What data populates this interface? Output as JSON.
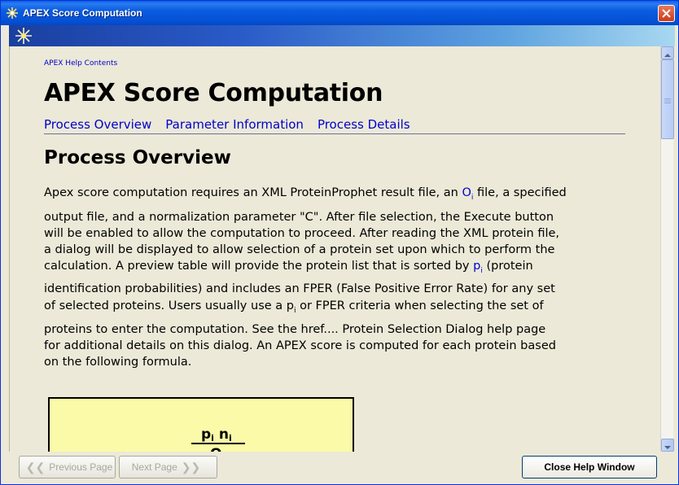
{
  "window": {
    "title": "APEX Score Computation",
    "accent_color": "#0a5ce0"
  },
  "content": {
    "help_link": "APEX Help Contents",
    "page_title": "APEX Score Computation",
    "nav": [
      {
        "label": "Process Overview"
      },
      {
        "label": "Parameter Information"
      },
      {
        "label": "Process Details"
      }
    ],
    "section_title": "Process Overview",
    "paragraph": {
      "l1a": "Apex score computation requires an XML ProteinProphet result file, an ",
      "o_sym": "O",
      "o_sub": "i",
      "l1b": " file, a specified",
      "l2": "output file, and a normalization parameter \"C\". After file selection, the Execute button",
      "l3": "will be enabled to allow the computation to proceed. After reading the XML protein file,",
      "l4": "a dialog will be displayed to allow selection of a protein set upon which to perform the",
      "l5a": "calculation. A preview table will provide the protein list that is sorted by ",
      "p_sym": "p",
      "p_sub": "i",
      "l5b": " (protein",
      "l6": "identification probabilities) and includes an FPER (False Positive Error Rate) for any set",
      "l7a": "of selected proteins. Users usually use a p",
      "l7_sub": "i",
      "l7b": " or FPER criteria when selecting the set of",
      "l8": "proteins to enter the computation. See the href.... Protein Selection Dialog help page",
      "l9": "for additional details on this dialog. An APEX score is computed for each protein based",
      "l10": "on the following formula."
    },
    "formula": {
      "numerator": "p",
      "numerator_sub": "i",
      "numerator2": " n",
      "numerator2_sub": "i",
      "denominator": "O"
    }
  },
  "footer": {
    "previous_label": "Previous Page",
    "next_label": "Next Page",
    "close_label": "Close Help Window"
  }
}
